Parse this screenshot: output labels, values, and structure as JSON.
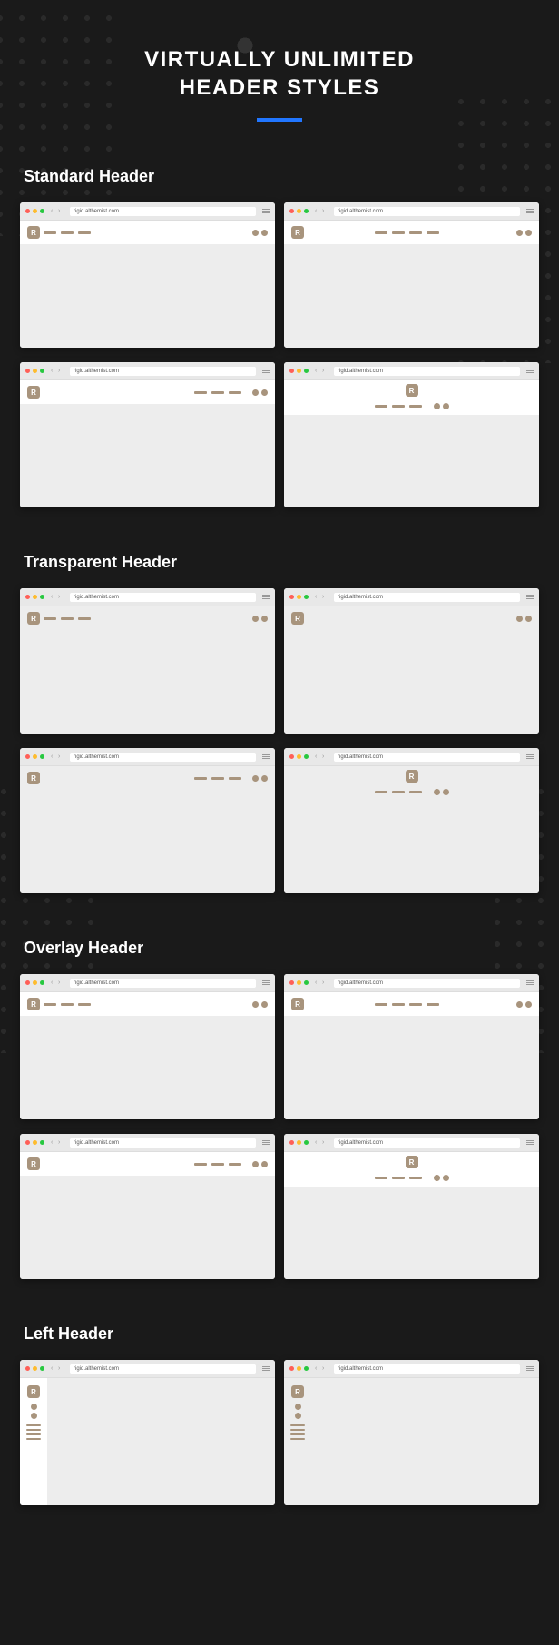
{
  "title_line1": "VIRTUALLY UNLIMITED",
  "title_line2": "HEADER STYLES",
  "url": "rigid.althemist.com",
  "sections": [
    {
      "title": "Standard Header"
    },
    {
      "title": "Transparent Header"
    },
    {
      "title": "Overlay Header"
    },
    {
      "title": "Left Header"
    }
  ],
  "logo_letter": "R"
}
